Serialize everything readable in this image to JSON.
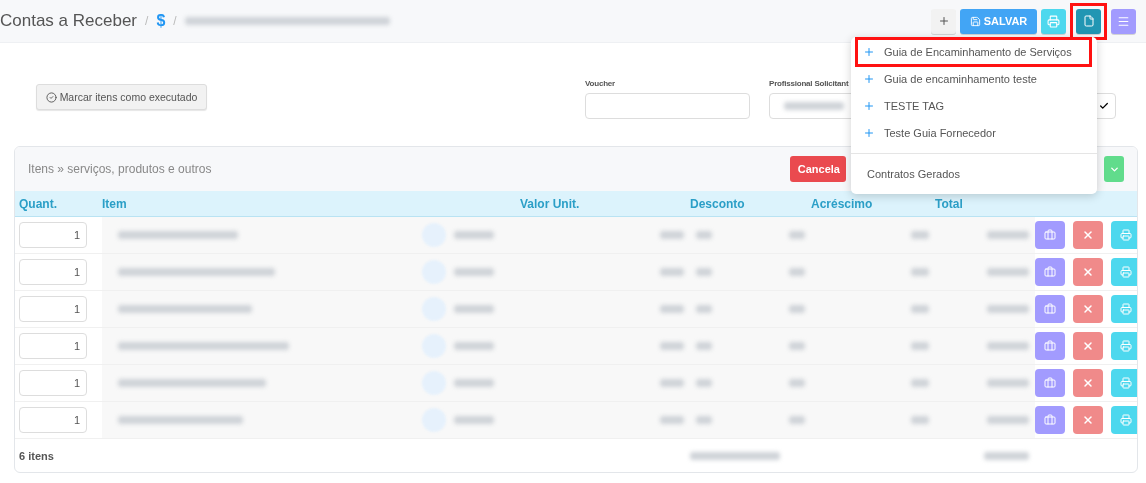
{
  "breadcrumb": {
    "title": "Contas a Receber",
    "separator_1": "/",
    "icon_text": "$",
    "separator_2": "/"
  },
  "toolbar": [
    {
      "kind": "add"
    },
    {
      "kind": "save",
      "label": "SALVAR"
    },
    {
      "kind": "print"
    },
    {
      "kind": "document",
      "highlighted": true
    },
    {
      "kind": "menu"
    }
  ],
  "form": {
    "mark_button": "Marcar itens como executado",
    "fields": [
      {
        "label": "Voucher",
        "kind": "input"
      },
      {
        "label": "Profissional Solicitant",
        "kind": "blurred"
      }
    ]
  },
  "items_card": {
    "title": "Itens » serviços, produtos e outros",
    "actions": [
      {
        "label": "Cancela",
        "kind": "danger"
      }
    ],
    "columns": [
      "Quant.",
      "Item",
      "Valor Unit.",
      "Desconto",
      "Acréscimo",
      "Total"
    ],
    "rows": [
      {
        "quantity": "1"
      },
      {
        "quantity": "1"
      },
      {
        "quantity": "1"
      },
      {
        "quantity": "1"
      },
      {
        "quantity": "1"
      },
      {
        "quantity": "1"
      }
    ],
    "footer": "6 itens"
  },
  "dropdown": {
    "items": [
      {
        "kind": "add",
        "label": "Guia de Encaminhamento de Serviços",
        "highlighted": true
      },
      {
        "kind": "add",
        "label": "Guia de encaminhamento teste",
        "highlighted": false
      },
      {
        "kind": "add",
        "label": "TESTE TAG",
        "highlighted": false
      },
      {
        "kind": "add",
        "label": "Teste Guia Fornecedor",
        "highlighted": false
      },
      {
        "kind": "divider"
      },
      {
        "kind": "plain",
        "label": "Contratos Gerados",
        "highlighted": false
      }
    ]
  }
}
